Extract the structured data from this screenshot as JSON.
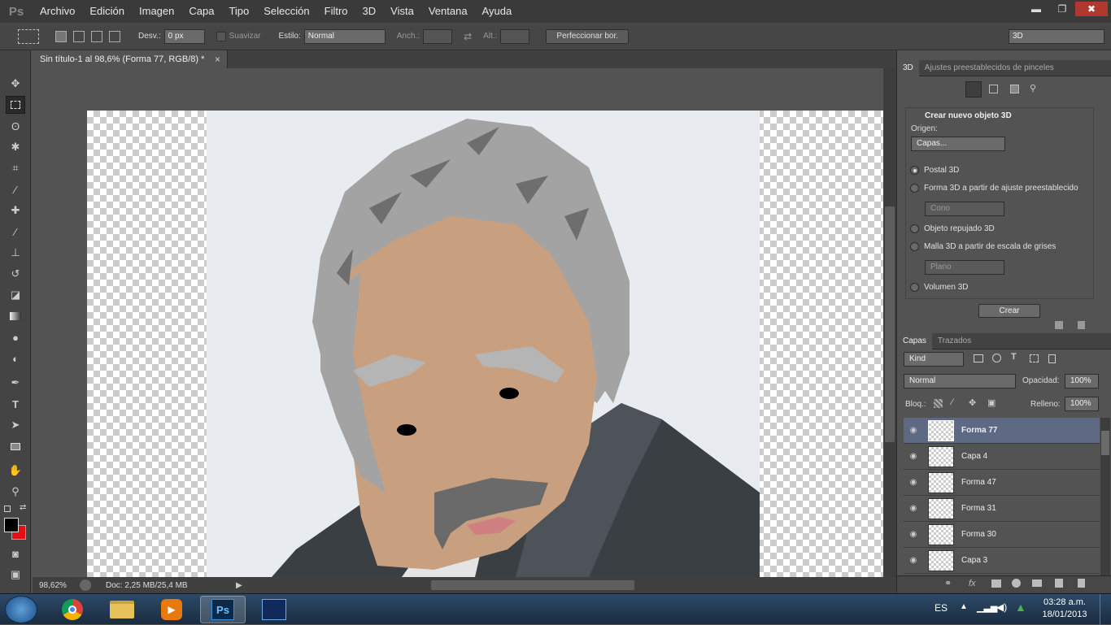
{
  "app": {
    "logo": "Ps"
  },
  "menu": [
    "Archivo",
    "Edición",
    "Imagen",
    "Capa",
    "Tipo",
    "Selección",
    "Filtro",
    "3D",
    "Vista",
    "Ventana",
    "Ayuda"
  ],
  "window_controls": {
    "minimize": "▬",
    "restore": "❐",
    "close": "✖"
  },
  "options": {
    "desv_label": "Desv.:",
    "desv_value": "0 px",
    "suavizar_label": "Suavizar",
    "estilo_label": "Estilo:",
    "estilo_value": "Normal",
    "anch_label": "Anch.:",
    "alt_label": "Alt.:",
    "refine_button": "Perfeccionar bor.",
    "workspace": "3D"
  },
  "document": {
    "tab_title": "Sin título-1 al 98,6% (Forma 77, RGB/8) *",
    "close": "×"
  },
  "status": {
    "zoom": "98,62%",
    "doc": "Doc: 2,25 MB/25,4 MB"
  },
  "panel3d": {
    "tabs": [
      "3D",
      "Ajustes preestablecidos de pinceles"
    ],
    "section_title": "Crear nuevo objeto 3D",
    "origin_label": "Origen:",
    "origin_value": "Capas...",
    "options": [
      {
        "label": "Postal 3D",
        "selected": true
      },
      {
        "label": "Forma 3D a partir de ajuste preestablecido",
        "selected": false
      },
      {
        "label": "Objeto repujado 3D",
        "selected": false
      },
      {
        "label": "Malla 3D a partir de escala de grises",
        "selected": false
      },
      {
        "label": "Volumen 3D",
        "selected": false
      }
    ],
    "shape_preset": "Cono",
    "mesh_preset": "Plano",
    "create_button": "Crear"
  },
  "layers_panel": {
    "tabs": [
      "Capas",
      "Trazados"
    ],
    "kind": "Kind",
    "blend": "Normal",
    "opacity_label": "Opacidad:",
    "opacity_value": "100%",
    "lock_label": "Bloq.:",
    "fill_label": "Relleno:",
    "fill_value": "100%",
    "layers": [
      {
        "name": "Forma 77",
        "selected": true
      },
      {
        "name": "Capa 4",
        "selected": false
      },
      {
        "name": "Forma 47",
        "selected": false
      },
      {
        "name": "Forma 31",
        "selected": false
      },
      {
        "name": "Forma 30",
        "selected": false
      },
      {
        "name": "Capa 3",
        "selected": false
      }
    ]
  },
  "taskbar": {
    "lang": "ES",
    "time": "03:28 a.m.",
    "date": "18/01/2013",
    "ps_label": "Ps"
  }
}
